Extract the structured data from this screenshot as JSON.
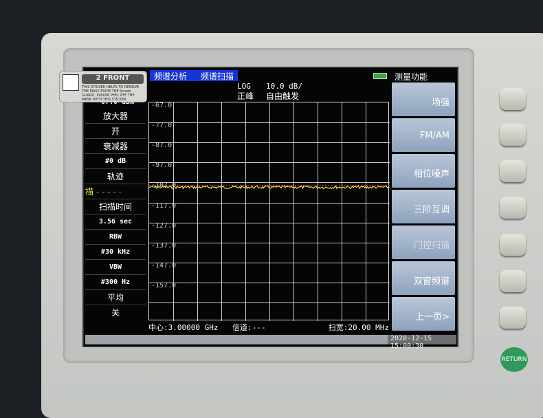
{
  "sticker": {
    "number": "2",
    "label": "FRONT",
    "text": "THIS STICKER HELPS TO REMOVE THE MASK FROM THE Screen GUARD. PLEASE PEEL OFF THE MASK WITH THIS STICKER"
  },
  "header": {
    "mode": "频谱分析",
    "submode": "频谱扫描",
    "scale_type": "LOG",
    "scale": "10.0 dB/",
    "detector": "正峰",
    "trigger": "自由触发"
  },
  "left_panel": {
    "ref_level": "-67.0 dBm",
    "amp_label": "放大器",
    "amp_value": "开",
    "atten_label": "衰减器",
    "atten_value": "#0 dB",
    "trace_label": "轨迹",
    "trace_mode": "描",
    "sweep_label": "扫描时间",
    "sweep_value": "3.56 sec",
    "rbw_label": "RBW",
    "rbw_value": "#30 kHz",
    "vbw_label": "VBW",
    "vbw_value": "#300 Hz",
    "avg_label": "平均",
    "avg_value": "关"
  },
  "y_ticks": [
    "-67.0",
    "-77.0",
    "-87.0",
    "-97.0",
    "-107.0",
    "-117.0",
    "-127.0",
    "-137.0",
    "-147.0",
    "-157.0"
  ],
  "trace": {
    "level_dbm": -108,
    "marker_line_dbm": -107,
    "color": "#f2e63a"
  },
  "footer": {
    "center": "中心:3.00000 GHz",
    "channel": "信道:---",
    "span": "扫宽:20.00 MHz",
    "datetime": "2020-12-15 15:00:30"
  },
  "softkeys": {
    "title": "测量功能",
    "items": [
      "场强",
      "FM/AM",
      "相位噪声",
      "三阶互调",
      "门控扫描",
      "双窗频谱",
      "上一页>"
    ]
  },
  "hardware": {
    "return_label": "RETURN"
  }
}
